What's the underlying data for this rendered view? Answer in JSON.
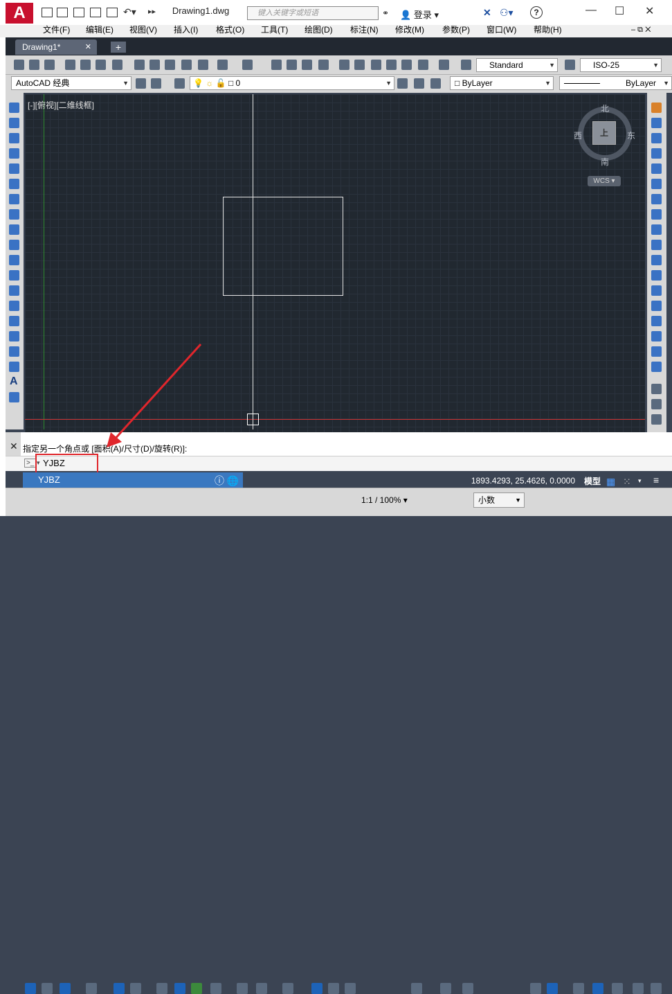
{
  "title_bar": {
    "logo": "A",
    "document_title": "Drawing1.dwg",
    "search_placeholder": "键入关键字或短语",
    "login_label": "登录",
    "help_label": "?",
    "minimize": "—",
    "maximize": "☐",
    "close": "✕"
  },
  "menu": {
    "items": [
      "文件(F)",
      "编辑(E)",
      "视图(V)",
      "插入(I)",
      "格式(O)",
      "工具(T)",
      "绘图(D)",
      "标注(N)",
      "修改(M)",
      "参数(P)",
      "窗口(W)",
      "帮助(H)"
    ]
  },
  "tabs": {
    "drawing_tab": "Drawing1*",
    "add_tab": "+"
  },
  "toolbar": {
    "text_style": "Standard",
    "dim_style": "ISO-25",
    "workspace": "AutoCAD 经典",
    "layer": "0",
    "color": "ByLayer",
    "linetype": "ByLayer"
  },
  "viewport": {
    "view_label": "[-][俯视][二维线框]",
    "compass_north": "北",
    "compass_south": "南",
    "compass_east": "东",
    "compass_west": "西",
    "viewcube_face": "上",
    "wcs_label": "WCS"
  },
  "command": {
    "prompt": "指定另一个角点或 [面积(A)/尺寸(D)/旋转(R)]:",
    "input_value": "YJBZ",
    "autocomplete_item": "YJBZ"
  },
  "status_bar": {
    "coordinates": "1893.4293, 25.4626, 0.0000",
    "model_label": "模型",
    "annotation_scale": "1:1 / 100%",
    "units": "小数"
  },
  "colors": {
    "canvas_bg": "#212830",
    "annotation_red": "#e0262c",
    "autocomplete_blue": "#3a78c0"
  }
}
